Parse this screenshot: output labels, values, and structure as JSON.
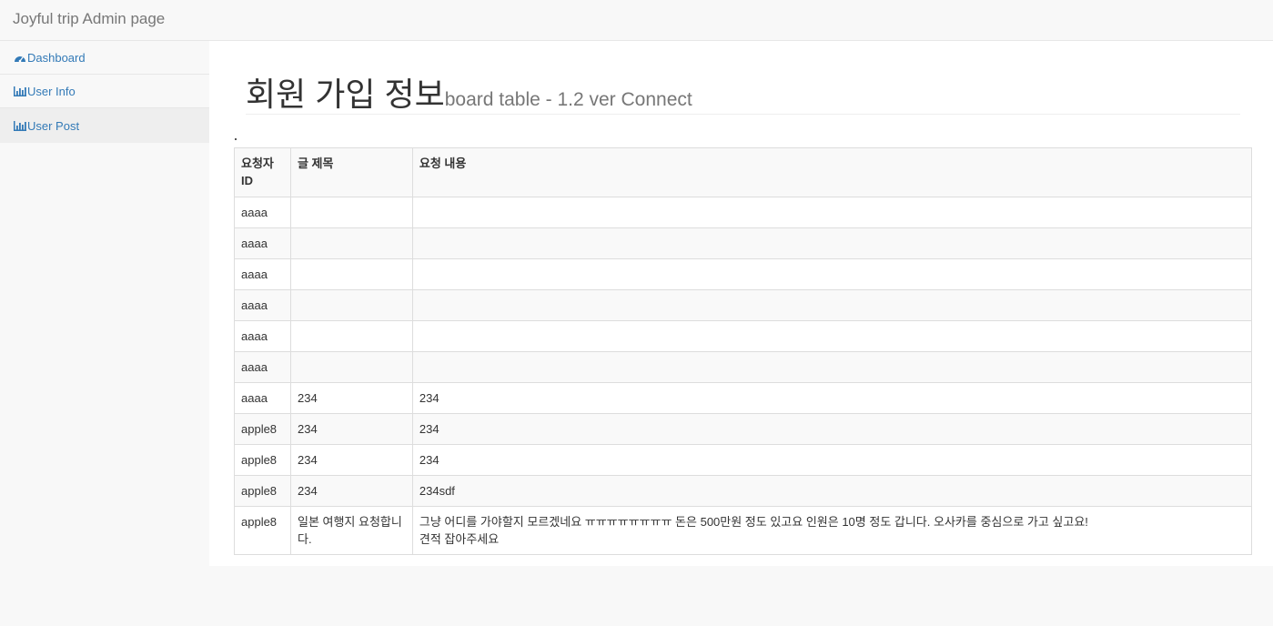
{
  "app": {
    "brand": "Joyful trip Admin page"
  },
  "sidebar": {
    "items": [
      {
        "label": "Dashboard",
        "icon": "dashboard-icon"
      },
      {
        "label": "User Info",
        "icon": "bar-chart-icon"
      },
      {
        "label": "User Post",
        "icon": "bar-chart-icon"
      }
    ],
    "active_index": 2
  },
  "page": {
    "title": "회원 가입 정보",
    "subtitle": "board table - 1.2 ver Connect"
  },
  "table": {
    "headers": [
      "요청자 ID",
      "글 제목",
      "요청 내용"
    ],
    "rows": [
      [
        "aaaa",
        "",
        ""
      ],
      [
        "aaaa",
        "",
        ""
      ],
      [
        "aaaa",
        "",
        ""
      ],
      [
        "aaaa",
        "",
        ""
      ],
      [
        "aaaa",
        "",
        ""
      ],
      [
        "aaaa",
        "",
        ""
      ],
      [
        "aaaa",
        "234",
        "234"
      ],
      [
        "apple8",
        "234",
        "234"
      ],
      [
        "apple8",
        "234",
        "234"
      ],
      [
        "apple8",
        "234",
        "234sdf"
      ],
      [
        "apple8",
        "일본 여행지 요청합니다.",
        "그냥 어디를 가야할지 모르겠네요 ㅠㅠㅠㅠㅠㅠㅠㅠ 돈은 500만원 정도 있고요 인원은 10명 정도 갑니다. 오사카를 중심으로 가고 싶고요! 견적 잡아주세요"
      ]
    ]
  },
  "colors": {
    "link": "#337ab7",
    "border": "#dddddd",
    "stripe": "#f9f9f9",
    "navbar_bg": "#f8f8f8"
  }
}
